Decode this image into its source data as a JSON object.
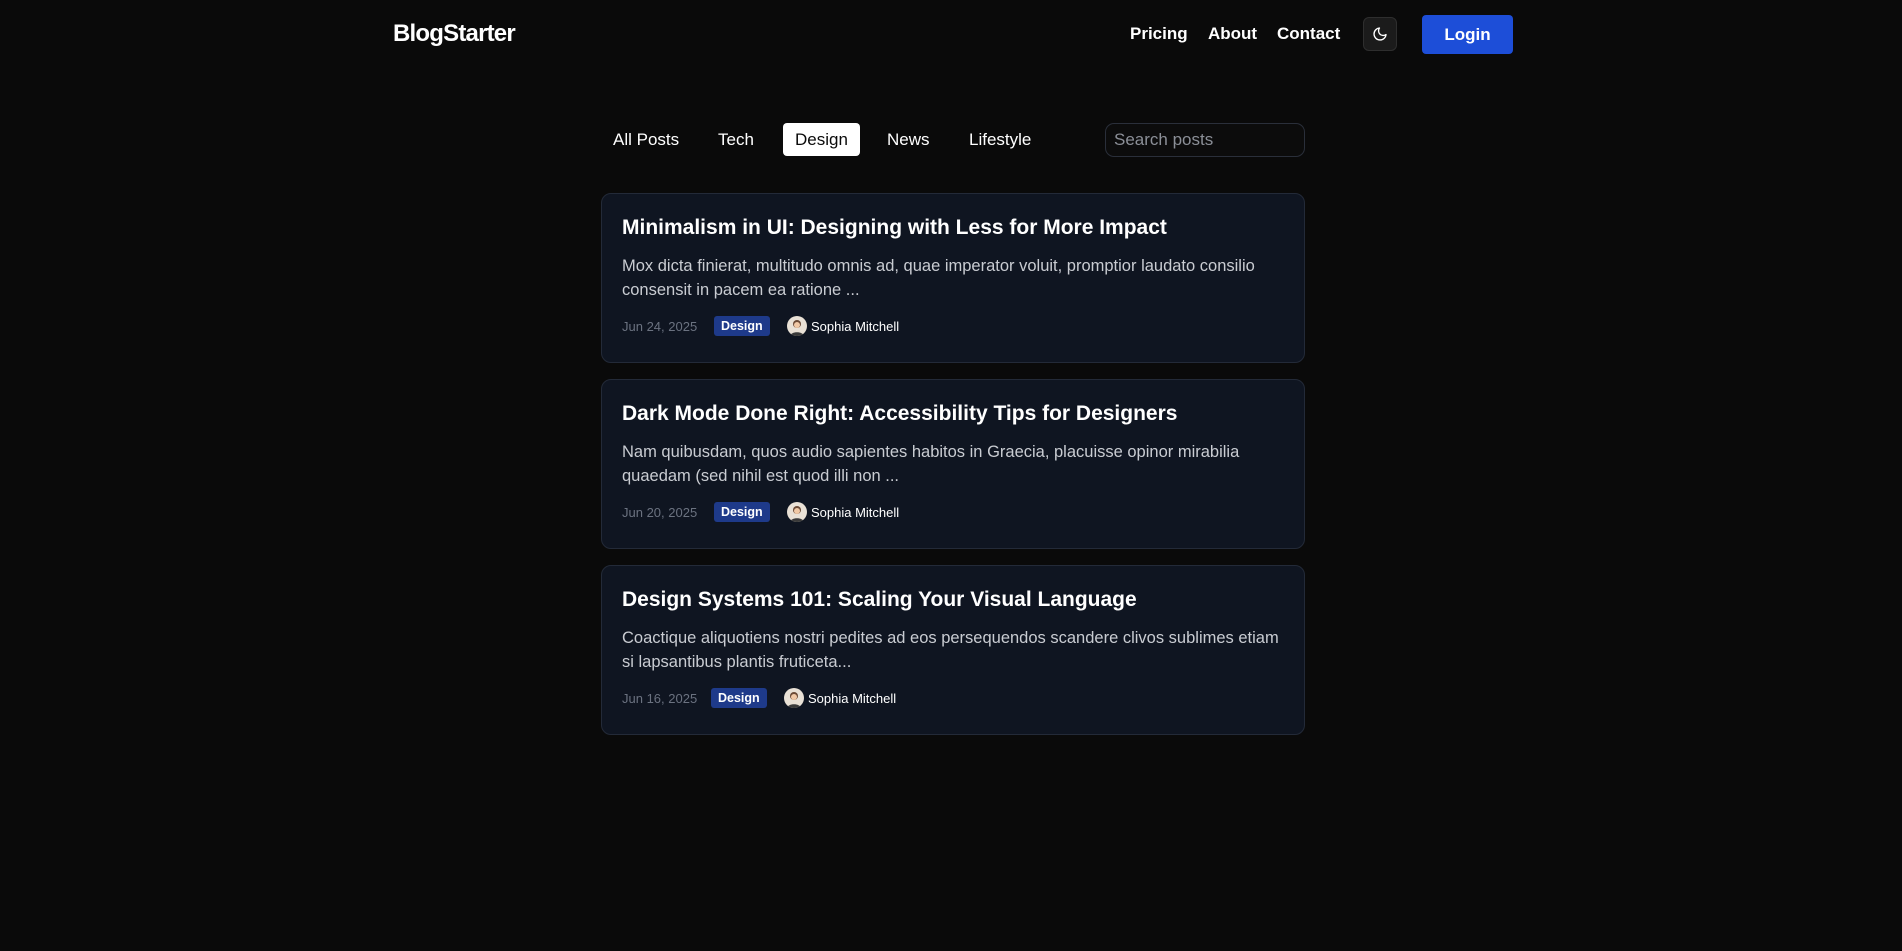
{
  "header": {
    "logo": "BlogStarter",
    "nav": [
      "Pricing",
      "About",
      "Contact"
    ],
    "theme_icon": "moon-icon",
    "login_label": "Login"
  },
  "filters": {
    "items": [
      "All Posts",
      "Tech",
      "Design",
      "News",
      "Lifestyle"
    ],
    "active": "Design"
  },
  "search": {
    "placeholder": "Search posts",
    "value": ""
  },
  "posts": [
    {
      "title": "Minimalism in UI: Designing with Less for More Impact",
      "excerpt": "Mox dicta finierat, multitudo omnis ad, quae imperator voluit, promptior laudato consilio consensit in pacem ea ratione ...",
      "date": "Jun 24, 2025",
      "tag": "Design",
      "author": "Sophia Mitchell"
    },
    {
      "title": "Dark Mode Done Right: Accessibility Tips for Designers",
      "excerpt": "Nam quibusdam, quos audio sapientes habitos in Graecia, placuisse opinor mirabilia quaedam (sed nihil est quod illi non ...",
      "date": "Jun 20, 2025",
      "tag": "Design",
      "author": "Sophia Mitchell"
    },
    {
      "title": "Design Systems 101: Scaling Your Visual Language",
      "excerpt": "Coactique aliquotiens nostri pedites ad eos persequendos scandere clivos sublimes etiam si lapsantibus plantis fruticeta...",
      "date": "Jun 16, 2025",
      "tag": "Design",
      "author": "Sophia Mitchell"
    }
  ],
  "colors": {
    "background": "#0a0a0a",
    "card": "#0f1521",
    "accent": "#1d4ed8",
    "tag": "#1e3a8a"
  }
}
